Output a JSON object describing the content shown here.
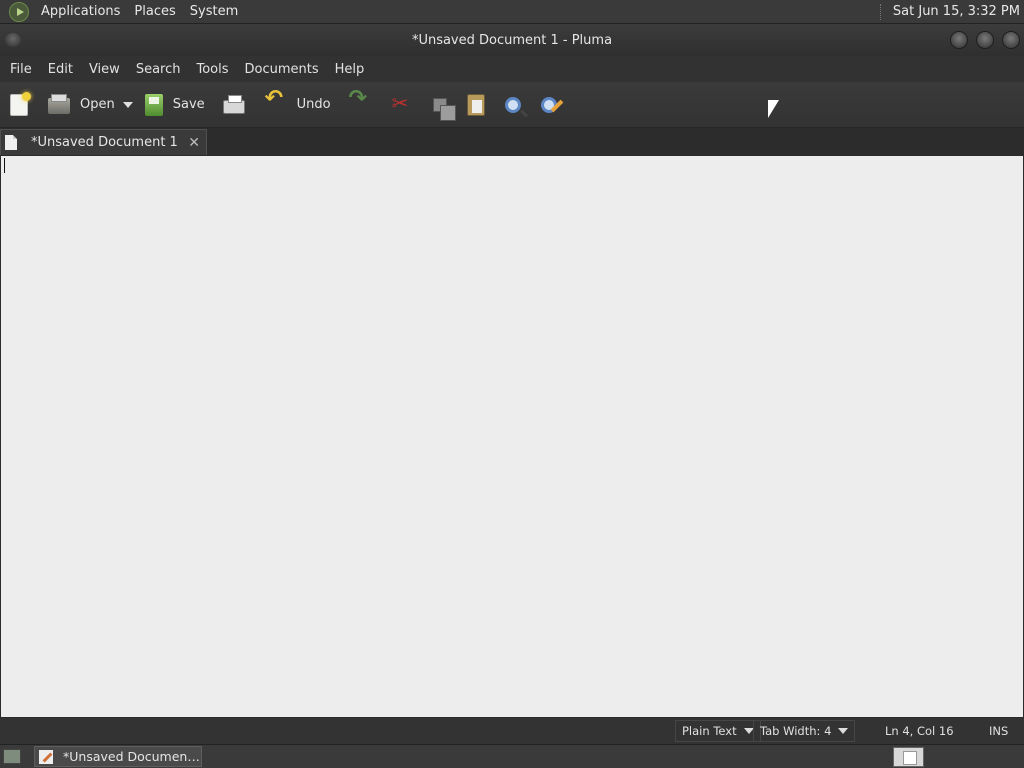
{
  "top_panel": {
    "menus": [
      "Applications",
      "Places",
      "System"
    ],
    "clock": "Sat Jun 15,  3:32 PM"
  },
  "window": {
    "title": "*Unsaved Document 1 - Pluma"
  },
  "menubar": {
    "items": [
      "File",
      "Edit",
      "View",
      "Search",
      "Tools",
      "Documents",
      "Help"
    ]
  },
  "toolbar": {
    "open_label": "Open",
    "save_label": "Save",
    "undo_label": "Undo"
  },
  "tab": {
    "label": "*Unsaved Document 1",
    "close": "✕"
  },
  "editor": {
    "lines": []
  },
  "statusbar": {
    "language": "Plain Text",
    "tab_width": "Tab Width:  4",
    "position": "Ln 4, Col 16",
    "mode": "INS"
  },
  "bottom_panel": {
    "task_label": "*Unsaved Documen…"
  }
}
